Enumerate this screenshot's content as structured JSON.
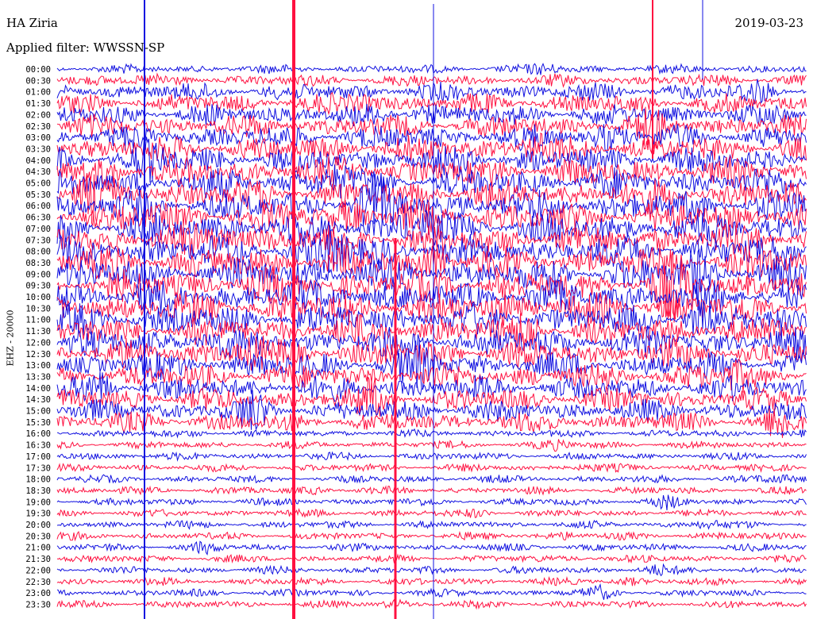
{
  "header": {
    "station": "HA Ziria",
    "filter": "Applied filter: WWSSN-SP",
    "date": "2019-03-23"
  },
  "chart_data": {
    "type": "line",
    "title": "HA Ziria",
    "subtitle": "Applied filter: WWSSN-SP",
    "date": "2019-03-23",
    "ylabel": "EHZ - 20000",
    "row_labels": [
      "00:00",
      "00:30",
      "01:00",
      "01:30",
      "02:00",
      "02:30",
      "03:00",
      "03:30",
      "04:00",
      "04:30",
      "05:00",
      "05:30",
      "06:00",
      "06:30",
      "07:00",
      "07:30",
      "08:00",
      "08:30",
      "09:00",
      "09:30",
      "10:00",
      "10:30",
      "11:00",
      "11:30",
      "12:00",
      "12:30",
      "13:00",
      "13:30",
      "14:00",
      "14:30",
      "15:00",
      "15:30",
      "16:00",
      "16:30",
      "17:00",
      "17:30",
      "18:00",
      "18:30",
      "19:00",
      "19:30",
      "20:00",
      "20:30",
      "21:00",
      "21:30",
      "22:00",
      "22:30",
      "23:00",
      "23:30"
    ],
    "series_colors": [
      "#1010e0",
      "#ff1040"
    ],
    "grid": false,
    "note_colors": "traces alternate blue (even rows) and red (odd rows)"
  }
}
